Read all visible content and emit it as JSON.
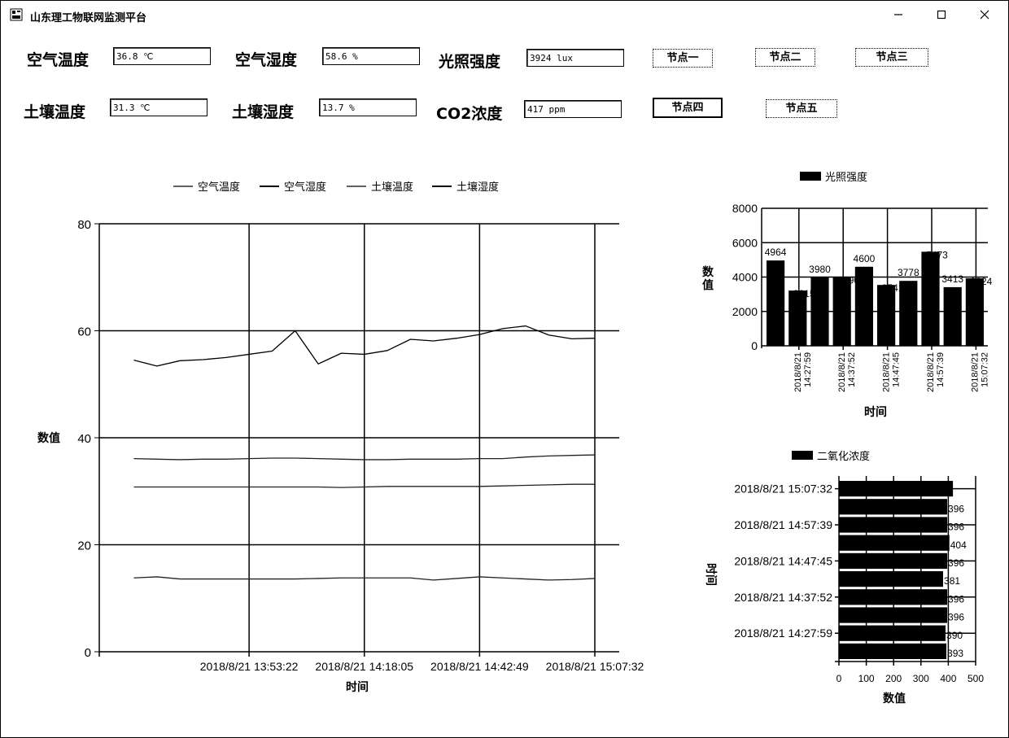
{
  "window": {
    "title": "山东理工物联网监测平台",
    "controls": {
      "minimize": "—",
      "maximize": "☐",
      "close": "✕"
    }
  },
  "readings": {
    "air_temp": {
      "label": "空气温度",
      "value": "36.8 ℃"
    },
    "air_humidity": {
      "label": "空气湿度",
      "value": "58.6 %"
    },
    "light": {
      "label": "光照强度",
      "value": "3924 lux"
    },
    "soil_temp": {
      "label": "土壤温度",
      "value": "31.3 ℃"
    },
    "soil_humidity": {
      "label": "土壤湿度",
      "value": "13.7 %"
    },
    "co2": {
      "label": "CO2浓度",
      "value": "417 ppm"
    }
  },
  "nodes": [
    {
      "label": "节点一",
      "active": false
    },
    {
      "label": "节点二",
      "active": false
    },
    {
      "label": "节点三",
      "active": false
    },
    {
      "label": "节点四",
      "active": true
    },
    {
      "label": "节点五",
      "active": false
    }
  ],
  "chart_data": [
    {
      "type": "line",
      "title": "",
      "xlabel": "时间",
      "ylabel": "数值",
      "ylim": [
        0,
        80
      ],
      "yticks": [
        0,
        20,
        40,
        60,
        80
      ],
      "xticks": [
        "2018/8/21 13:53:22",
        "2018/8/21 14:18:05",
        "2018/8/21 14:42:49",
        "2018/8/21 15:07:32"
      ],
      "legend_position": "top",
      "grid": true,
      "x_range": [
        -1.5,
        20
      ],
      "xtick_positions": [
        5,
        10,
        15,
        20
      ],
      "series": [
        {
          "name": "空气温度",
          "values": [
            36.1,
            36.0,
            35.9,
            36.0,
            36.0,
            36.1,
            36.2,
            36.2,
            36.1,
            36.0,
            35.9,
            35.9,
            36.0,
            36.0,
            36.0,
            36.1,
            36.1,
            36.4,
            36.6,
            36.7,
            36.8
          ]
        },
        {
          "name": "空气湿度",
          "values": [
            54.5,
            53.4,
            54.4,
            54.6,
            55.0,
            55.6,
            56.2,
            60.0,
            53.8,
            55.8,
            55.6,
            56.3,
            58.4,
            58.1,
            58.6,
            59.3,
            60.4,
            60.9,
            59.2,
            58.5,
            58.6
          ]
        },
        {
          "name": "土壤温度",
          "values": [
            30.8,
            30.8,
            30.8,
            30.8,
            30.8,
            30.8,
            30.8,
            30.8,
            30.8,
            30.7,
            30.8,
            30.9,
            30.9,
            30.9,
            30.9,
            30.9,
            31.0,
            31.1,
            31.2,
            31.3,
            31.3
          ]
        },
        {
          "name": "土壤湿度",
          "values": [
            13.8,
            14.0,
            13.6,
            13.6,
            13.6,
            13.6,
            13.6,
            13.6,
            13.7,
            13.8,
            13.8,
            13.8,
            13.8,
            13.4,
            13.7,
            14.0,
            13.8,
            13.6,
            13.4,
            13.5,
            13.7
          ]
        }
      ]
    },
    {
      "type": "bar",
      "title": "",
      "legend": "光照强度",
      "legend_position": "top",
      "xlabel": "时间",
      "ylabel": "数值",
      "ylim": [
        0,
        8000
      ],
      "yticks": [
        0,
        2000,
        4000,
        6000,
        8000
      ],
      "grid": true,
      "tick_labels": [
        "2018/8/21 14:27:59",
        "2018/8/21 14:37:52",
        "2018/8/21 14:47:45",
        "2018/8/21 14:57:39",
        "2018/8/21 15:07:32"
      ],
      "values": [
        4964,
        3215,
        3980,
        3990,
        4600,
        3541,
        3778,
        5473,
        3413,
        3924
      ],
      "data_labels": [
        "4964",
        "3215",
        "3980",
        "3990",
        "4600",
        "3541",
        "3778",
        "5473",
        "3413",
        "3924"
      ]
    },
    {
      "type": "bar",
      "orientation": "horizontal",
      "title": "",
      "legend": "二氧化浓度",
      "legend_position": "top",
      "xlabel": "数值",
      "ylabel": "时间",
      "xlim": [
        0,
        500
      ],
      "xticks": [
        0,
        100,
        200,
        300,
        400,
        500
      ],
      "grid": true,
      "tick_labels": [
        "2018/8/21 15:07:32",
        "2018/8/21 14:57:39",
        "2018/8/21 14:47:45",
        "2018/8/21 14:37:52",
        "2018/8/21 14:27:59"
      ],
      "values": [
        417,
        396,
        396,
        404,
        396,
        381,
        396,
        396,
        390,
        393
      ],
      "data_labels": [
        "",
        "396",
        "396",
        "404",
        "396",
        "381",
        "396",
        "396",
        "390",
        "393"
      ]
    }
  ]
}
